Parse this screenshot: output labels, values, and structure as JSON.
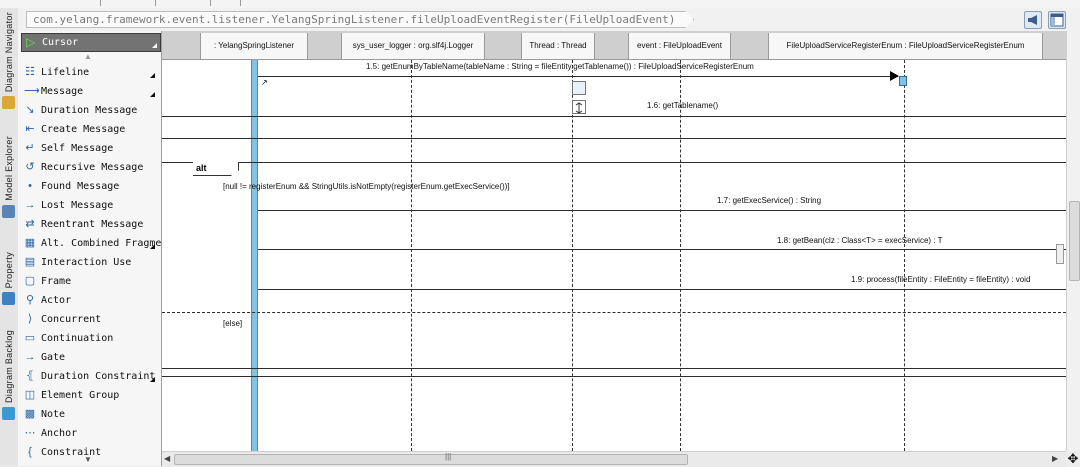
{
  "breadcrumb": "com.yelang.framework.event.listener.YelangSpringListener.fileUploadEventRegister(FileUploadEvent)",
  "side_tabs": [
    "Diagram Navigator",
    "Model Explorer",
    "Property",
    "Diagram Backlog"
  ],
  "palette": {
    "selected": "Cursor",
    "items": [
      {
        "label": "Lifeline",
        "icon": "lifeline-icon",
        "more": true
      },
      {
        "label": "Message",
        "icon": "message-arrow-icon",
        "more": true
      },
      {
        "label": "Duration Message",
        "icon": "duration-message-icon",
        "more": false
      },
      {
        "label": "Create Message",
        "icon": "create-message-icon",
        "more": false
      },
      {
        "label": "Self Message",
        "icon": "self-message-icon",
        "more": false
      },
      {
        "label": "Recursive Message",
        "icon": "recursive-message-icon",
        "more": false
      },
      {
        "label": "Found Message",
        "icon": "found-message-icon",
        "more": false
      },
      {
        "label": "Lost Message",
        "icon": "lost-message-icon",
        "more": false
      },
      {
        "label": "Reentrant Message",
        "icon": "reentrant-message-icon",
        "more": false
      },
      {
        "label": "Alt. Combined Fragment",
        "icon": "combined-fragment-icon",
        "more": true
      },
      {
        "label": "Interaction Use",
        "icon": "interaction-use-icon",
        "more": false
      },
      {
        "label": "Frame",
        "icon": "frame-icon",
        "more": false
      },
      {
        "label": "Actor",
        "icon": "actor-icon",
        "more": false
      },
      {
        "label": "Concurrent",
        "icon": "concurrent-icon",
        "more": false
      },
      {
        "label": "Continuation",
        "icon": "continuation-icon",
        "more": false
      },
      {
        "label": "Gate",
        "icon": "gate-icon",
        "more": false
      },
      {
        "label": "Duration Constraint",
        "icon": "duration-constraint-icon",
        "more": true
      },
      {
        "label": "Element Group",
        "icon": "element-group-icon",
        "more": false
      },
      {
        "label": "Note",
        "icon": "note-icon",
        "more": false
      },
      {
        "label": "Anchor",
        "icon": "anchor-icon",
        "more": false
      },
      {
        "label": "Constraint",
        "icon": "constraint-icon",
        "more": false
      }
    ]
  },
  "lifelines": [
    {
      "label": ": YelangSpringListener"
    },
    {
      "label": "sys_user_logger : org.slf4j.Logger"
    },
    {
      "label": "Thread : Thread"
    },
    {
      "label": "event : FileUploadEvent"
    },
    {
      "label": "FileUploadServiceRegisterEnum : FileUploadServiceRegisterEnum"
    }
  ],
  "messages": [
    {
      "label": "1.5: getEnumByTableName(tableName : String = fileEntity.getTablename()) : FileUploadServiceRegisterEnum"
    },
    {
      "label": "1.6: getTablename()"
    },
    {
      "label": "1.7: getExecService() : String"
    },
    {
      "label": "1.8: getBean(clz : Class<T> = execService) : T"
    },
    {
      "label": "1.9: process(fileEntity : FileEntity = fileEntity) : void"
    }
  ],
  "fragment": {
    "operator": "alt",
    "guard_1": "[null != registerEnum && StringUtils.isNotEmpty(registerEnum.getExecService())]",
    "guard_2": "[else]"
  },
  "colors": {
    "activation": "#83c2e6",
    "palette_selected": "#737373",
    "cursor_icon": "#6fe04d"
  }
}
